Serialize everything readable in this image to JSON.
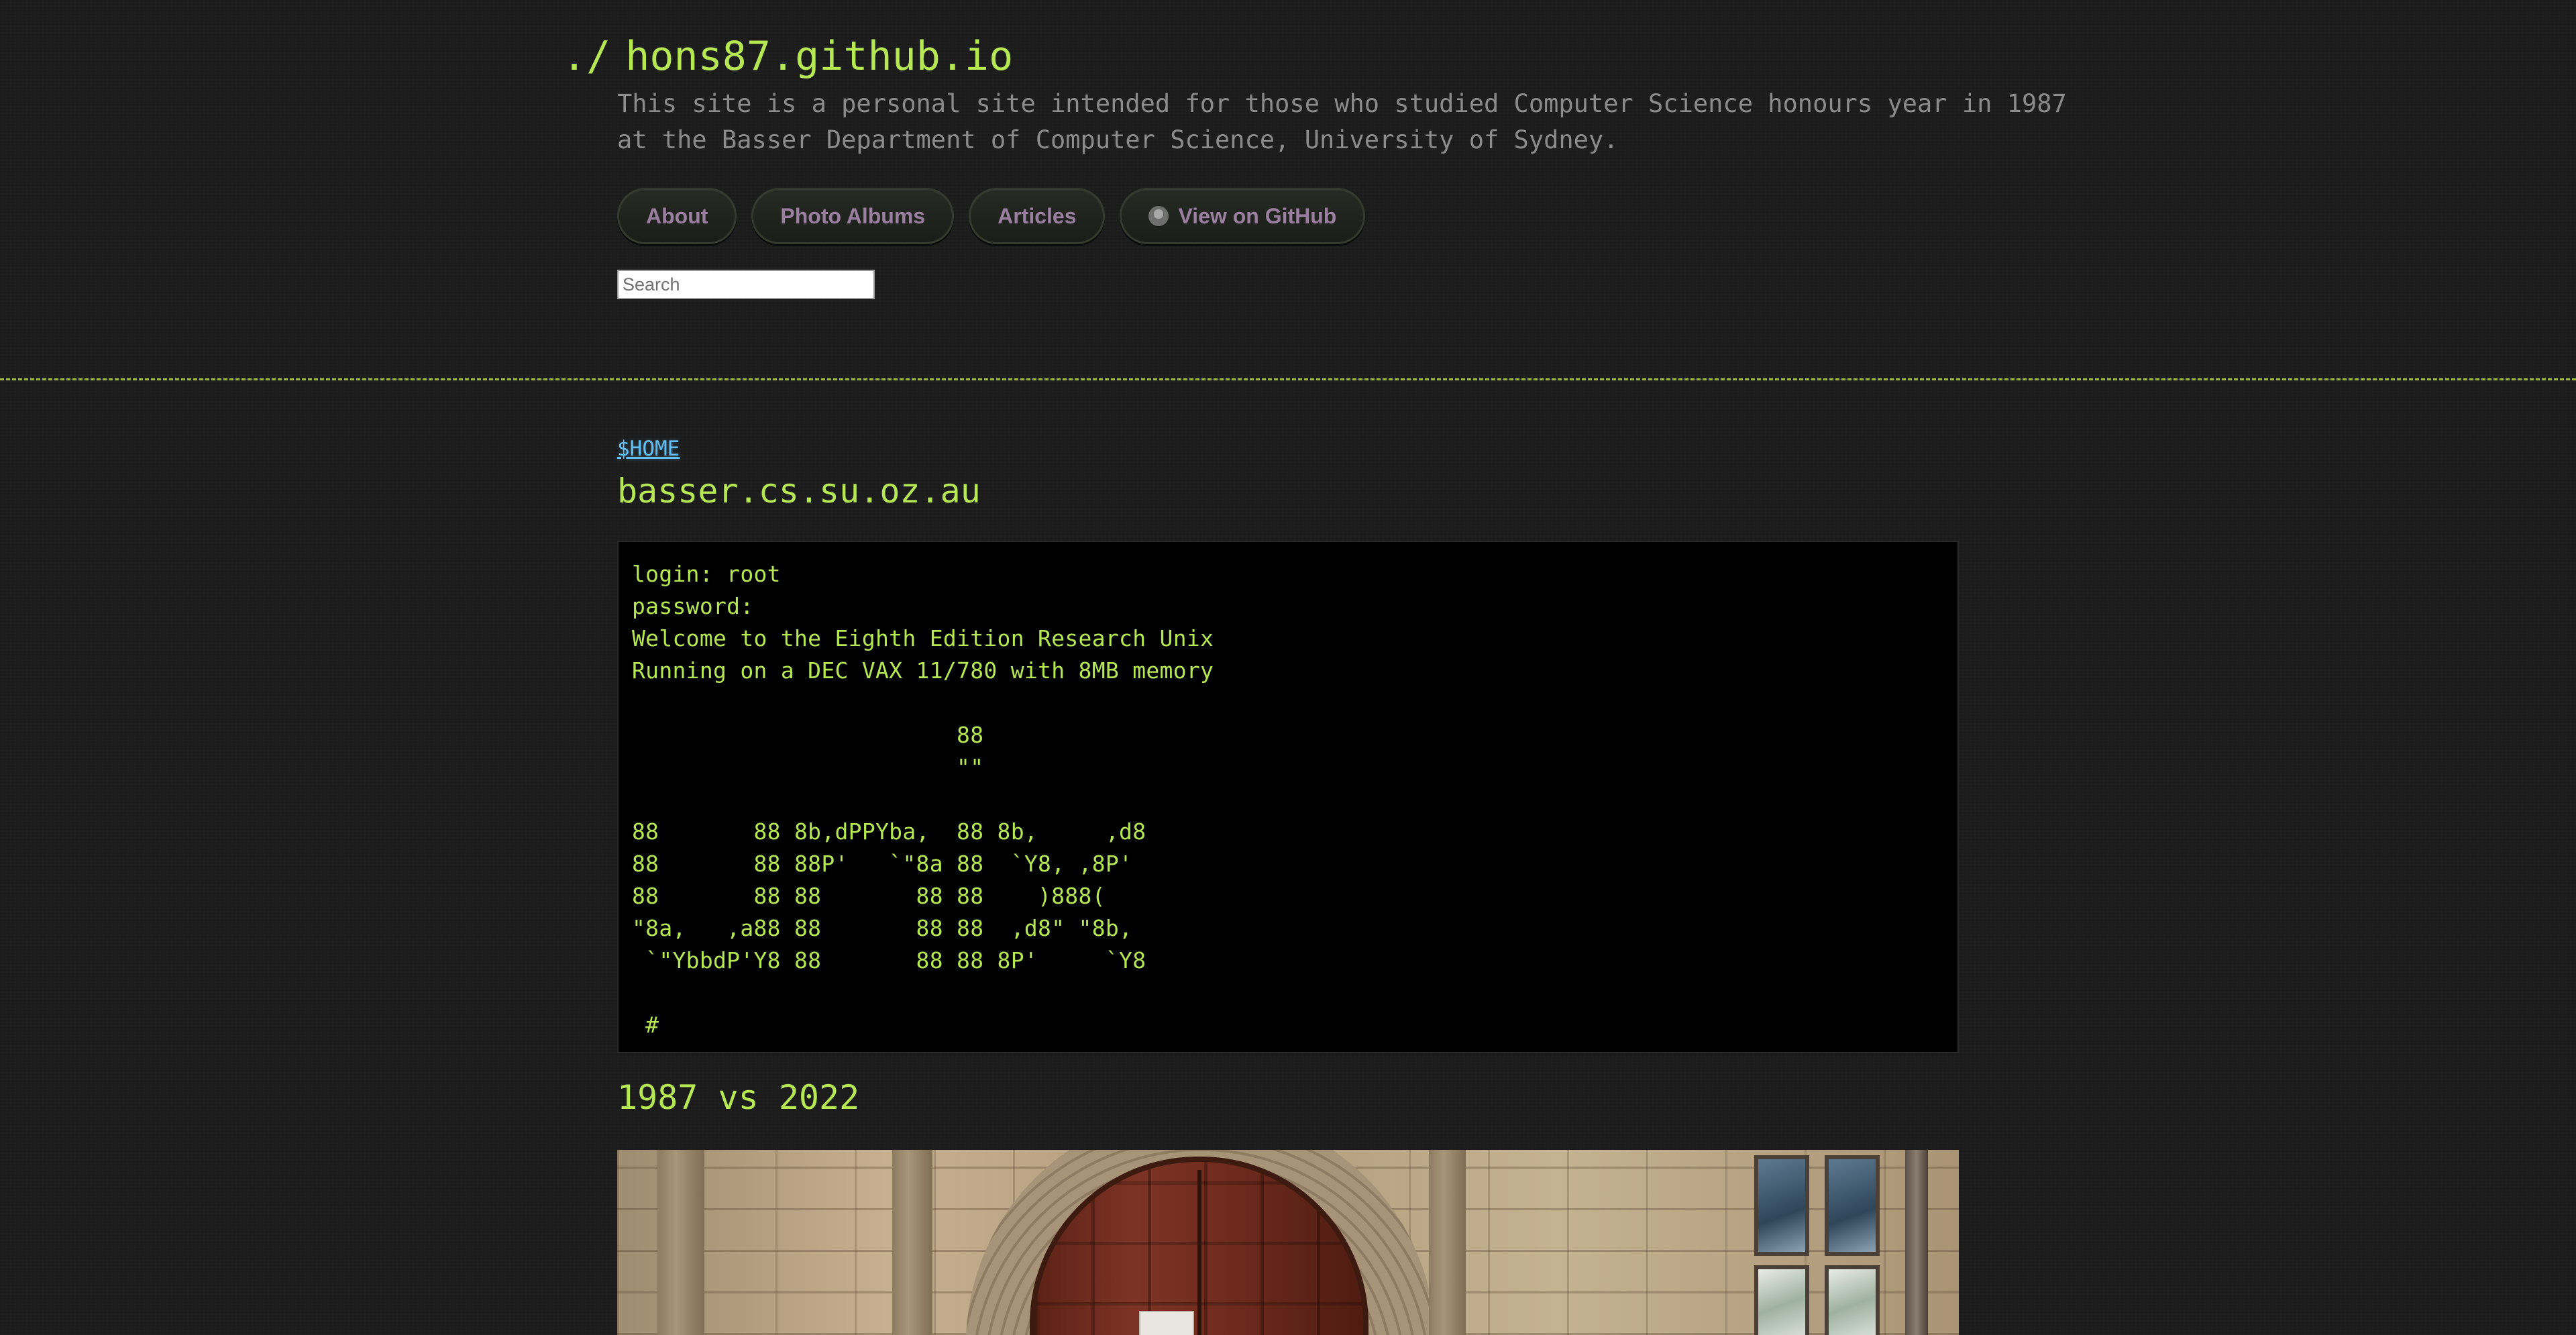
{
  "header": {
    "prompt": "./",
    "site_title": "hons87.github.io",
    "description_line1": "This site is a personal site intended for those who studied Computer Science honours year in 1987",
    "description_line2": "at the Basser Department of Computer Science, University of Sydney."
  },
  "nav": [
    {
      "label": "About"
    },
    {
      "label": "Photo Albums"
    },
    {
      "label": "Articles"
    },
    {
      "label": "View on GitHub",
      "icon": "github-icon"
    }
  ],
  "search": {
    "placeholder": "Search",
    "value": ""
  },
  "content": {
    "breadcrumb": "$HOME",
    "page_title": "basser.cs.su.oz.au",
    "terminal": "login: root\npassword:\nWelcome to the Eighth Edition Research Unix\nRunning on a DEC VAX 11/780 with 8MB memory\n\n                        88\n                        \"\"\n\n88       88 8b,dPPYba,  88 8b,     ,d8\n88       88 88P'   `\"8a 88  `Y8, ,8P'\n88       88 88       88 88    )888(\n\"8a,   ,a88 88       88 88  ,d8\" \"8b,\n `\"YbbdP'Y8 88       88 88 8P'     `Y8\n\n #",
    "section_title": "1987 vs 2022"
  },
  "colors": {
    "background": "#1c1c1c",
    "accent_green": "#b5e853",
    "link_blue": "#63c0f5",
    "nav_text": "#9a7fa0",
    "muted_text": "#8b8b8b",
    "divider": "#a4bf3c"
  }
}
